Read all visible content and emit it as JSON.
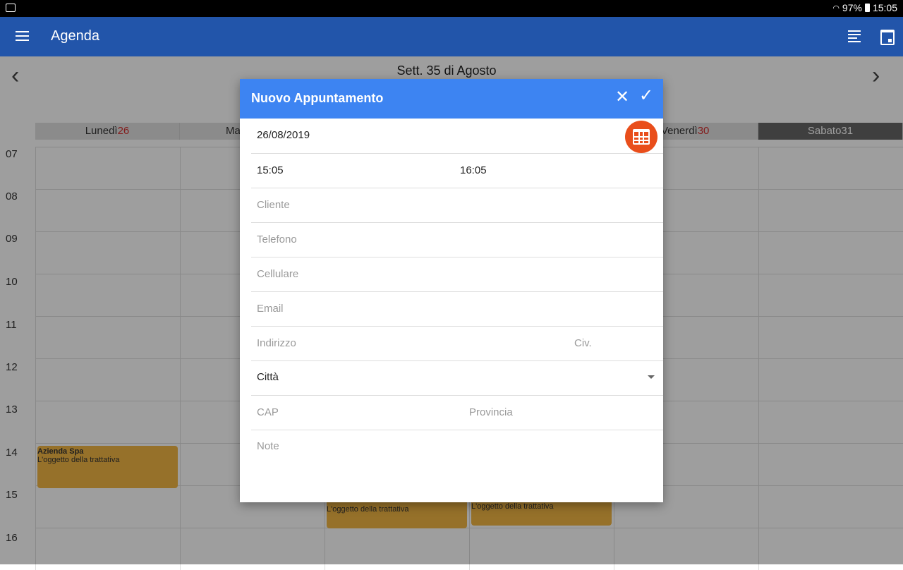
{
  "status": {
    "battery": "97%",
    "time": "15:05"
  },
  "appbar": {
    "title": "Agenda"
  },
  "calendar": {
    "week_title": "Sett. 35 di Agosto",
    "days": [
      {
        "name": "Lunedì",
        "num": "26"
      },
      {
        "name": "Ma",
        "num": ""
      },
      {
        "name": "",
        "num": ""
      },
      {
        "name": "",
        "num": ""
      },
      {
        "name": "Venerdì",
        "num": "30"
      },
      {
        "name": "Sabato",
        "num": "31"
      }
    ],
    "hours": [
      "07",
      "08",
      "09",
      "10",
      "11",
      "12",
      "13",
      "14",
      "15",
      "16"
    ],
    "events": [
      {
        "title": "Azienda Spa",
        "subject": "L'oggetto della trattativa"
      },
      {
        "title": "",
        "subject": "L'oggetto della trattativa"
      },
      {
        "title": "",
        "subject": "L'oggetto della trattativa"
      }
    ]
  },
  "dialog": {
    "title": "Nuovo Appuntamento",
    "date": "26/08/2019",
    "start_time": "15:05",
    "end_time": "16:05",
    "placeholders": {
      "cliente": "Cliente",
      "telefono": "Telefono",
      "cellulare": "Cellulare",
      "email": "Email",
      "indirizzo": "Indirizzo",
      "civ": "Civ.",
      "cap": "CAP",
      "provincia": "Provincia",
      "note": "Note"
    },
    "citta": "Città"
  }
}
